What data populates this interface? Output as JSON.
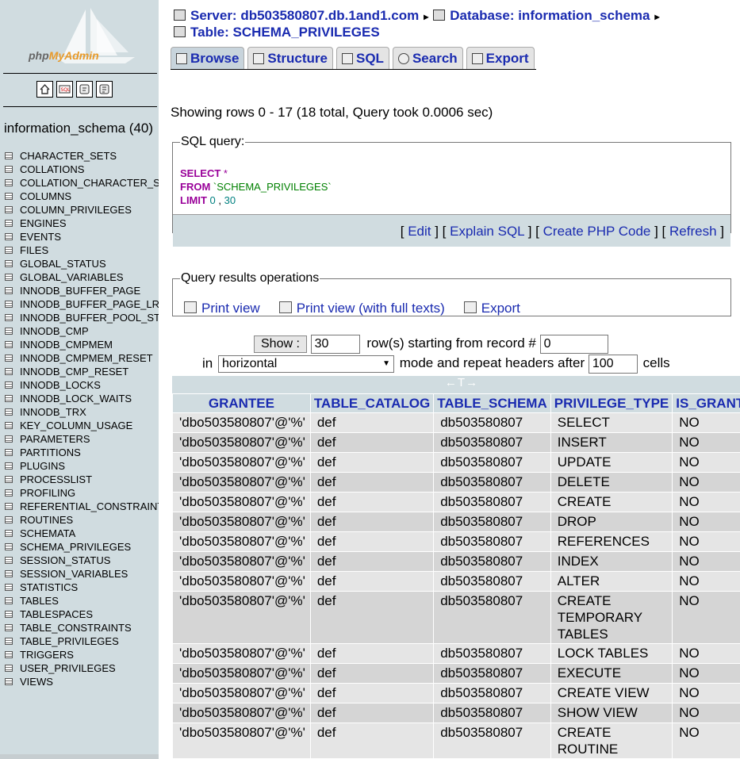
{
  "sidebar": {
    "logo_text_a": "php",
    "logo_text_b": "MyAdmin",
    "icon_labels": [
      "home",
      "SQL",
      "query",
      "docs"
    ],
    "db_title": "information_schema (40)",
    "tables": [
      "CHARACTER_SETS",
      "COLLATIONS",
      "COLLATION_CHARACTER_SE",
      "COLUMNS",
      "COLUMN_PRIVILEGES",
      "ENGINES",
      "EVENTS",
      "FILES",
      "GLOBAL_STATUS",
      "GLOBAL_VARIABLES",
      "INNODB_BUFFER_PAGE",
      "INNODB_BUFFER_PAGE_LRU",
      "INNODB_BUFFER_POOL_STA",
      "INNODB_CMP",
      "INNODB_CMPMEM",
      "INNODB_CMPMEM_RESET",
      "INNODB_CMP_RESET",
      "INNODB_LOCKS",
      "INNODB_LOCK_WAITS",
      "INNODB_TRX",
      "KEY_COLUMN_USAGE",
      "PARAMETERS",
      "PARTITIONS",
      "PLUGINS",
      "PROCESSLIST",
      "PROFILING",
      "REFERENTIAL_CONSTRAINTS",
      "ROUTINES",
      "SCHEMATA",
      "SCHEMA_PRIVILEGES",
      "SESSION_STATUS",
      "SESSION_VARIABLES",
      "STATISTICS",
      "TABLES",
      "TABLESPACES",
      "TABLE_CONSTRAINTS",
      "TABLE_PRIVILEGES",
      "TRIGGERS",
      "USER_PRIVILEGES",
      "VIEWS"
    ]
  },
  "breadcrumb": {
    "server": "Server: db503580807.db.1and1.com",
    "database": "Database: information_schema",
    "table": "Table: SCHEMA_PRIVILEGES",
    "arrow": "▸"
  },
  "tabs": [
    "Browse",
    "Structure",
    "SQL",
    "Search",
    "Export"
  ],
  "showing": "Showing rows 0 - 17 (18 total, Query took 0.0006 sec)",
  "sql": {
    "legend": "SQL query:",
    "select": "SELECT",
    "star": " *",
    "from": "FROM",
    "table": " `SCHEMA_PRIVILEGES`",
    "limit": "LIMIT",
    "offset": " 0",
    "comma": " , ",
    "count": "30",
    "links": [
      "Edit",
      "Explain SQL",
      "Create PHP Code",
      "Refresh"
    ]
  },
  "ops": {
    "legend": "Query results operations",
    "links": [
      "Print view",
      "Print view (with full texts)",
      "Export"
    ]
  },
  "nav": {
    "show_button": "Show :",
    "rows_value": "30",
    "rows_text": "row(s) starting from record #",
    "start_value": "0",
    "in_text": "in",
    "mode_value": "horizontal",
    "mode_text": "mode and repeat headers after",
    "repeat_value": "100",
    "cells_text": "cells"
  },
  "results": {
    "sort_control": "←T→",
    "columns": [
      "GRANTEE",
      "TABLE_CATALOG",
      "TABLE_SCHEMA",
      "PRIVILEGE_TYPE",
      "IS_GRANTABLE"
    ],
    "rows": [
      [
        "'dbo503580807'@'%'",
        "def",
        "db503580807",
        "SELECT",
        "NO"
      ],
      [
        "'dbo503580807'@'%'",
        "def",
        "db503580807",
        "INSERT",
        "NO"
      ],
      [
        "'dbo503580807'@'%'",
        "def",
        "db503580807",
        "UPDATE",
        "NO"
      ],
      [
        "'dbo503580807'@'%'",
        "def",
        "db503580807",
        "DELETE",
        "NO"
      ],
      [
        "'dbo503580807'@'%'",
        "def",
        "db503580807",
        "CREATE",
        "NO"
      ],
      [
        "'dbo503580807'@'%'",
        "def",
        "db503580807",
        "DROP",
        "NO"
      ],
      [
        "'dbo503580807'@'%'",
        "def",
        "db503580807",
        "REFERENCES",
        "NO"
      ],
      [
        "'dbo503580807'@'%'",
        "def",
        "db503580807",
        "INDEX",
        "NO"
      ],
      [
        "'dbo503580807'@'%'",
        "def",
        "db503580807",
        "ALTER",
        "NO"
      ],
      [
        "'dbo503580807'@'%'",
        "def",
        "db503580807",
        "CREATE TEMPORARY TABLES",
        "NO"
      ],
      [
        "'dbo503580807'@'%'",
        "def",
        "db503580807",
        "LOCK TABLES",
        "NO"
      ],
      [
        "'dbo503580807'@'%'",
        "def",
        "db503580807",
        "EXECUTE",
        "NO"
      ],
      [
        "'dbo503580807'@'%'",
        "def",
        "db503580807",
        "CREATE VIEW",
        "NO"
      ],
      [
        "'dbo503580807'@'%'",
        "def",
        "db503580807",
        "SHOW VIEW",
        "NO"
      ],
      [
        "'dbo503580807'@'%'",
        "def",
        "db503580807",
        "CREATE ROUTINE",
        "NO"
      ]
    ]
  }
}
